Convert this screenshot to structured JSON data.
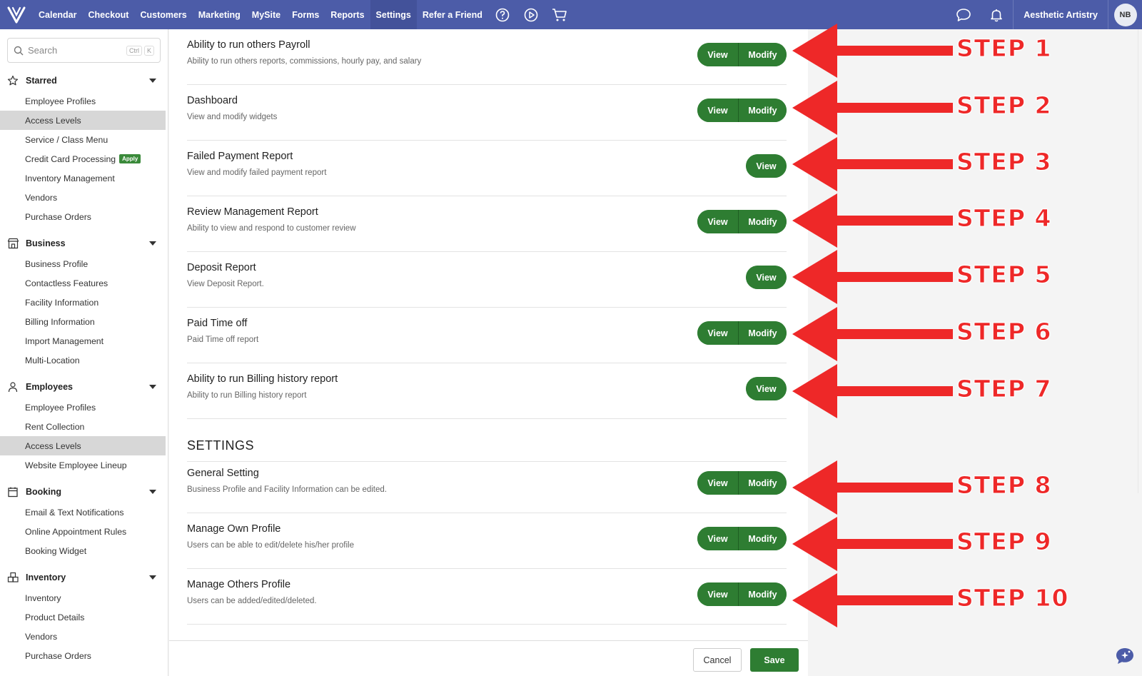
{
  "nav": {
    "items": [
      "Calendar",
      "Checkout",
      "Customers",
      "Marketing",
      "MySite",
      "Forms",
      "Reports",
      "Settings",
      "Refer a Friend"
    ],
    "active": "Settings",
    "business_name": "Aesthetic Artistry",
    "avatar_initials": "NB"
  },
  "sidebar": {
    "search_placeholder": "Search",
    "search_kbd_1": "Ctrl",
    "search_kbd_2": "K",
    "apply_badge": "Apply",
    "groups": [
      {
        "title": "Starred",
        "items": [
          "Employee Profiles",
          "Access Levels",
          "Service / Class Menu",
          "Credit Card Processing",
          "Inventory Management",
          "Vendors",
          "Purchase Orders"
        ]
      },
      {
        "title": "Business",
        "items": [
          "Business Profile",
          "Contactless Features",
          "Facility Information",
          "Billing Information",
          "Import Management",
          "Multi-Location"
        ]
      },
      {
        "title": "Employees",
        "items": [
          "Employee Profiles",
          "Rent Collection",
          "Access Levels",
          "Website Employee Lineup"
        ]
      },
      {
        "title": "Booking",
        "items": [
          "Email & Text Notifications",
          "Online Appointment Rules",
          "Booking Widget"
        ]
      },
      {
        "title": "Inventory",
        "items": [
          "Inventory",
          "Product Details",
          "Vendors",
          "Purchase Orders"
        ]
      }
    ]
  },
  "main": {
    "permissions": [
      {
        "title": "Ability to run others Payroll",
        "desc": "Ability to run others reports, commissions, hourly pay, and salary",
        "view": "View",
        "modify": "Modify"
      },
      {
        "title": "Dashboard",
        "desc": "View and modify widgets",
        "view": "View",
        "modify": "Modify"
      },
      {
        "title": "Failed Payment Report",
        "desc": "View and modify failed payment report",
        "view": "View"
      },
      {
        "title": "Review Management Report",
        "desc": "Ability to view and respond to customer review",
        "view": "View",
        "modify": "Modify"
      },
      {
        "title": "Deposit Report",
        "desc": "View Deposit Report.",
        "view": "View"
      },
      {
        "title": "Paid Time off",
        "desc": "Paid Time off report",
        "view": "View",
        "modify": "Modify"
      },
      {
        "title": "Ability to run Billing history report",
        "desc": "Ability to run Billing history report",
        "view": "View"
      }
    ],
    "settings_section_title": "SETTINGS",
    "settings": [
      {
        "title": "General Setting",
        "desc": "Business Profile and Facility Information can be edited.",
        "view": "View",
        "modify": "Modify"
      },
      {
        "title": "Manage Own Profile",
        "desc": "Users can be able to edit/delete his/her profile",
        "view": "View",
        "modify": "Modify"
      },
      {
        "title": "Manage Others Profile",
        "desc": "Users can be added/edited/deleted.",
        "view": "View",
        "modify": "Modify"
      }
    ]
  },
  "footer": {
    "cancel": "Cancel",
    "save": "Save"
  },
  "steps": [
    "STEP 1",
    "STEP 2",
    "STEP 3",
    "STEP 4",
    "STEP 5",
    "STEP 6",
    "STEP 7",
    "STEP 8",
    "STEP 9",
    "STEP 10"
  ],
  "colors": {
    "nav_bg": "#4c5ca8",
    "button_green": "#2e7d32",
    "arrow_red": "#ee2828"
  }
}
